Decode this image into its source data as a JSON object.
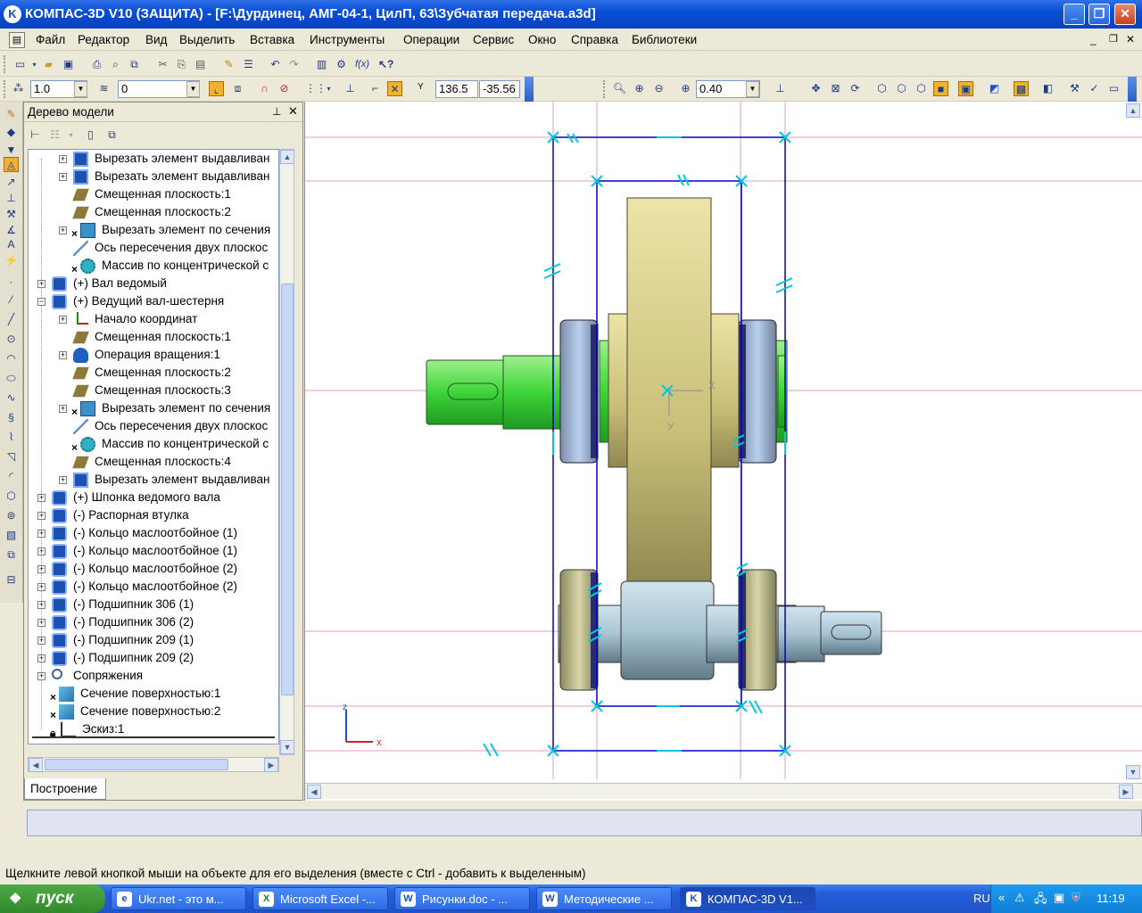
{
  "window": {
    "title": "КОМПАС-3D V10 (ЗАЩИТА) - [F:\\Дурдинец, АМГ-04-1, ЦилП, 63\\Зубчатая передача.a3d]",
    "logo": "K"
  },
  "menu": [
    "Файл",
    "Редактор",
    "Вид",
    "Выделить",
    "Вставка",
    "Инструменты",
    "Операции",
    "Сервис",
    "Окно",
    "Справка",
    "Библиотеки"
  ],
  "toolbar2": {
    "step": "1.0",
    "layer": "0",
    "x_coord": "136.5",
    "y_coord": "-35.56",
    "y_label": "Y"
  },
  "view_toolbar": {
    "zoom": "0.40"
  },
  "tree": {
    "title": "Дерево модели",
    "tab_label": "Построение",
    "items": [
      {
        "level": 2,
        "icon": "cut-extrude-icon",
        "label": "Вырезать элемент выдавливан",
        "exp": "+"
      },
      {
        "level": 2,
        "icon": "cut-extrude-icon",
        "label": "Вырезать элемент выдавливан",
        "exp": "+"
      },
      {
        "level": 2,
        "icon": "offset-plane-icon",
        "label": "Смещенная плоскость:1",
        "exp": ""
      },
      {
        "level": 2,
        "icon": "offset-plane-icon",
        "label": "Смещенная плоскость:2",
        "exp": ""
      },
      {
        "level": 2,
        "icon": "cut-section-icon",
        "label": "Вырезать элемент по сечения",
        "exp": "+",
        "x": true
      },
      {
        "level": 2,
        "icon": "axis-icon",
        "label": "Ось пересечения двух плоскос",
        "exp": ""
      },
      {
        "level": 2,
        "icon": "circular-array-icon",
        "label": "Массив по концентрической с",
        "exp": "",
        "x": true
      },
      {
        "level": 1,
        "icon": "part-icon",
        "label": "(+) Вал ведомый",
        "exp": "+"
      },
      {
        "level": 1,
        "icon": "part-icon",
        "label": "(+) Ведущий вал-шестерня",
        "exp": "−"
      },
      {
        "level": 2,
        "icon": "origin-icon",
        "label": "Начало координат",
        "exp": "+"
      },
      {
        "level": 2,
        "icon": "offset-plane-icon",
        "label": "Смещенная плоскость:1",
        "exp": ""
      },
      {
        "level": 2,
        "icon": "revolve-icon",
        "label": "Операция вращения:1",
        "exp": "+"
      },
      {
        "level": 2,
        "icon": "offset-plane-icon",
        "label": "Смещенная плоскость:2",
        "exp": ""
      },
      {
        "level": 2,
        "icon": "offset-plane-icon",
        "label": "Смещенная плоскость:3",
        "exp": ""
      },
      {
        "level": 2,
        "icon": "cut-section-icon",
        "label": "Вырезать элемент по сечения",
        "exp": "+",
        "x": true
      },
      {
        "level": 2,
        "icon": "axis-icon",
        "label": "Ось пересечения двух плоскос",
        "exp": ""
      },
      {
        "level": 2,
        "icon": "circular-array-icon",
        "label": "Массив по концентрической с",
        "exp": "",
        "x": true
      },
      {
        "level": 2,
        "icon": "offset-plane-icon",
        "label": "Смещенная плоскость:4",
        "exp": ""
      },
      {
        "level": 2,
        "icon": "cut-extrude-icon",
        "label": "Вырезать элемент выдавливан",
        "exp": "+"
      },
      {
        "level": 1,
        "icon": "part-icon",
        "label": "(+) Шпонка ведомого вала",
        "exp": "+"
      },
      {
        "level": 1,
        "icon": "part-icon",
        "label": "(-) Распорная втулка",
        "exp": "+"
      },
      {
        "level": 1,
        "icon": "part-icon",
        "label": "(-) Кольцо маслоотбойное (1)",
        "exp": "+"
      },
      {
        "level": 1,
        "icon": "part-icon",
        "label": "(-) Кольцо маслоотбойное (1)",
        "exp": "+"
      },
      {
        "level": 1,
        "icon": "part-icon",
        "label": "(-) Кольцо маслоотбойное (2)",
        "exp": "+"
      },
      {
        "level": 1,
        "icon": "part-icon",
        "label": "(-) Кольцо маслоотбойное (2)",
        "exp": "+"
      },
      {
        "level": 1,
        "icon": "part-icon",
        "label": "(-) Подшипник 306 (1)",
        "exp": "+"
      },
      {
        "level": 1,
        "icon": "part-icon",
        "label": "(-) Подшипник 306 (2)",
        "exp": "+"
      },
      {
        "level": 1,
        "icon": "part-icon",
        "label": "(-) Подшипник 209 (1)",
        "exp": "+"
      },
      {
        "level": 1,
        "icon": "part-icon",
        "label": "(-) Подшипник 209 (2)",
        "exp": "+"
      },
      {
        "level": 1,
        "icon": "mates-icon",
        "label": "Сопряжения",
        "exp": "+"
      },
      {
        "level": 1,
        "icon": "surface-section-icon",
        "label": "Сечение поверхностью:1",
        "exp": "",
        "x": true
      },
      {
        "level": 1,
        "icon": "surface-section-icon",
        "label": "Сечение поверхностью:2",
        "exp": "",
        "x": true
      },
      {
        "level": 1,
        "icon": "sketch-icon",
        "label": "Эскиз:1",
        "exp": "",
        "lock": true
      }
    ]
  },
  "viewport": {
    "axis_x": "x",
    "axis_z": "z",
    "axis_y": "У",
    "axis_x2": "X"
  },
  "status": {
    "message": "Щелкните левой кнопкой мыши на объекте для его выделения (вместе с Ctrl - добавить к выделенным)"
  },
  "taskbar": {
    "start": "пуск",
    "tasks": [
      {
        "icon": "e",
        "label": "Ukr.net - это м..."
      },
      {
        "icon": "X",
        "label": "Microsoft Excel -..."
      },
      {
        "icon": "W",
        "label": "Рисунки.doc - ..."
      },
      {
        "icon": "W",
        "label": "Методические ..."
      },
      {
        "icon": "K",
        "label": "КОМПАС-3D V1..."
      }
    ],
    "lang": "RU",
    "clock": "11:19"
  },
  "colors": {
    "accent": "#0a4fd6",
    "sketch": "#0000c8",
    "constraint": "#00c8e0",
    "gear": "#d8cf86",
    "shaft_green": "#3fd43a",
    "bearing": "#a7bedc",
    "shaft2": "#a9c4d2"
  }
}
